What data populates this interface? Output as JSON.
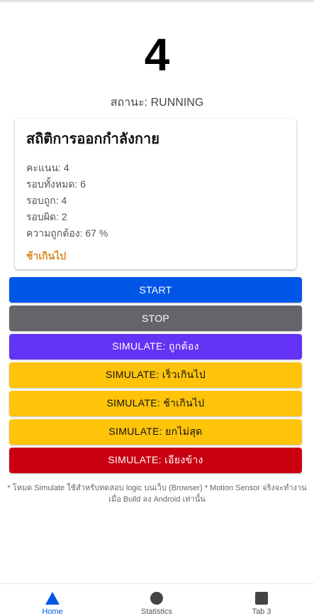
{
  "score": "4",
  "status_text": "สถานะ: RUNNING",
  "stats_card": {
    "title": "สถิติการออกกำลังกาย",
    "rows": [
      "คะแนน: 4",
      "รอบทั้งหมด: 6",
      "รอบถูก: 4",
      "รอบผิด: 2",
      "ความถูกต้อง: 67 %"
    ],
    "feedback": "ช้าเกินไป",
    "feedback_color": "#d4891f"
  },
  "buttons": [
    {
      "label": "START",
      "bg": "#0057e7",
      "fg": "#ffffff"
    },
    {
      "label": "STOP",
      "bg": "#63656b",
      "fg": "#ffffff"
    },
    {
      "label": "SIMULATE: ถูกต้อง",
      "bg": "#6433f5",
      "fg": "#ffffff"
    },
    {
      "label": "SIMULATE: เร็วเกินไป",
      "bg": "#ffc30a",
      "fg": "#111111"
    },
    {
      "label": "SIMULATE: ช้าเกินไป",
      "bg": "#ffc30a",
      "fg": "#111111"
    },
    {
      "label": "SIMULATE: ยกไม่สุด",
      "bg": "#ffc30a",
      "fg": "#111111"
    },
    {
      "label": "SIMULATE: เอียงข้าง",
      "bg": "#c9000f",
      "fg": "#ffffff"
    }
  ],
  "note": "* โหมด Simulate ใช้สำหรับทดสอบ logic บนเว็บ (Browser) * Motion Sensor จริงจะทำงานเมื่อ Build ลง Android เท่านั้น",
  "tabs": [
    {
      "label": "Home",
      "icon": "triangle-icon",
      "active": true,
      "color": "#0057e7"
    },
    {
      "label": "Statistics",
      "icon": "circle-icon",
      "active": false,
      "color": "#444444"
    },
    {
      "label": "Tab 3",
      "icon": "square-icon",
      "active": false,
      "color": "#444444"
    }
  ]
}
